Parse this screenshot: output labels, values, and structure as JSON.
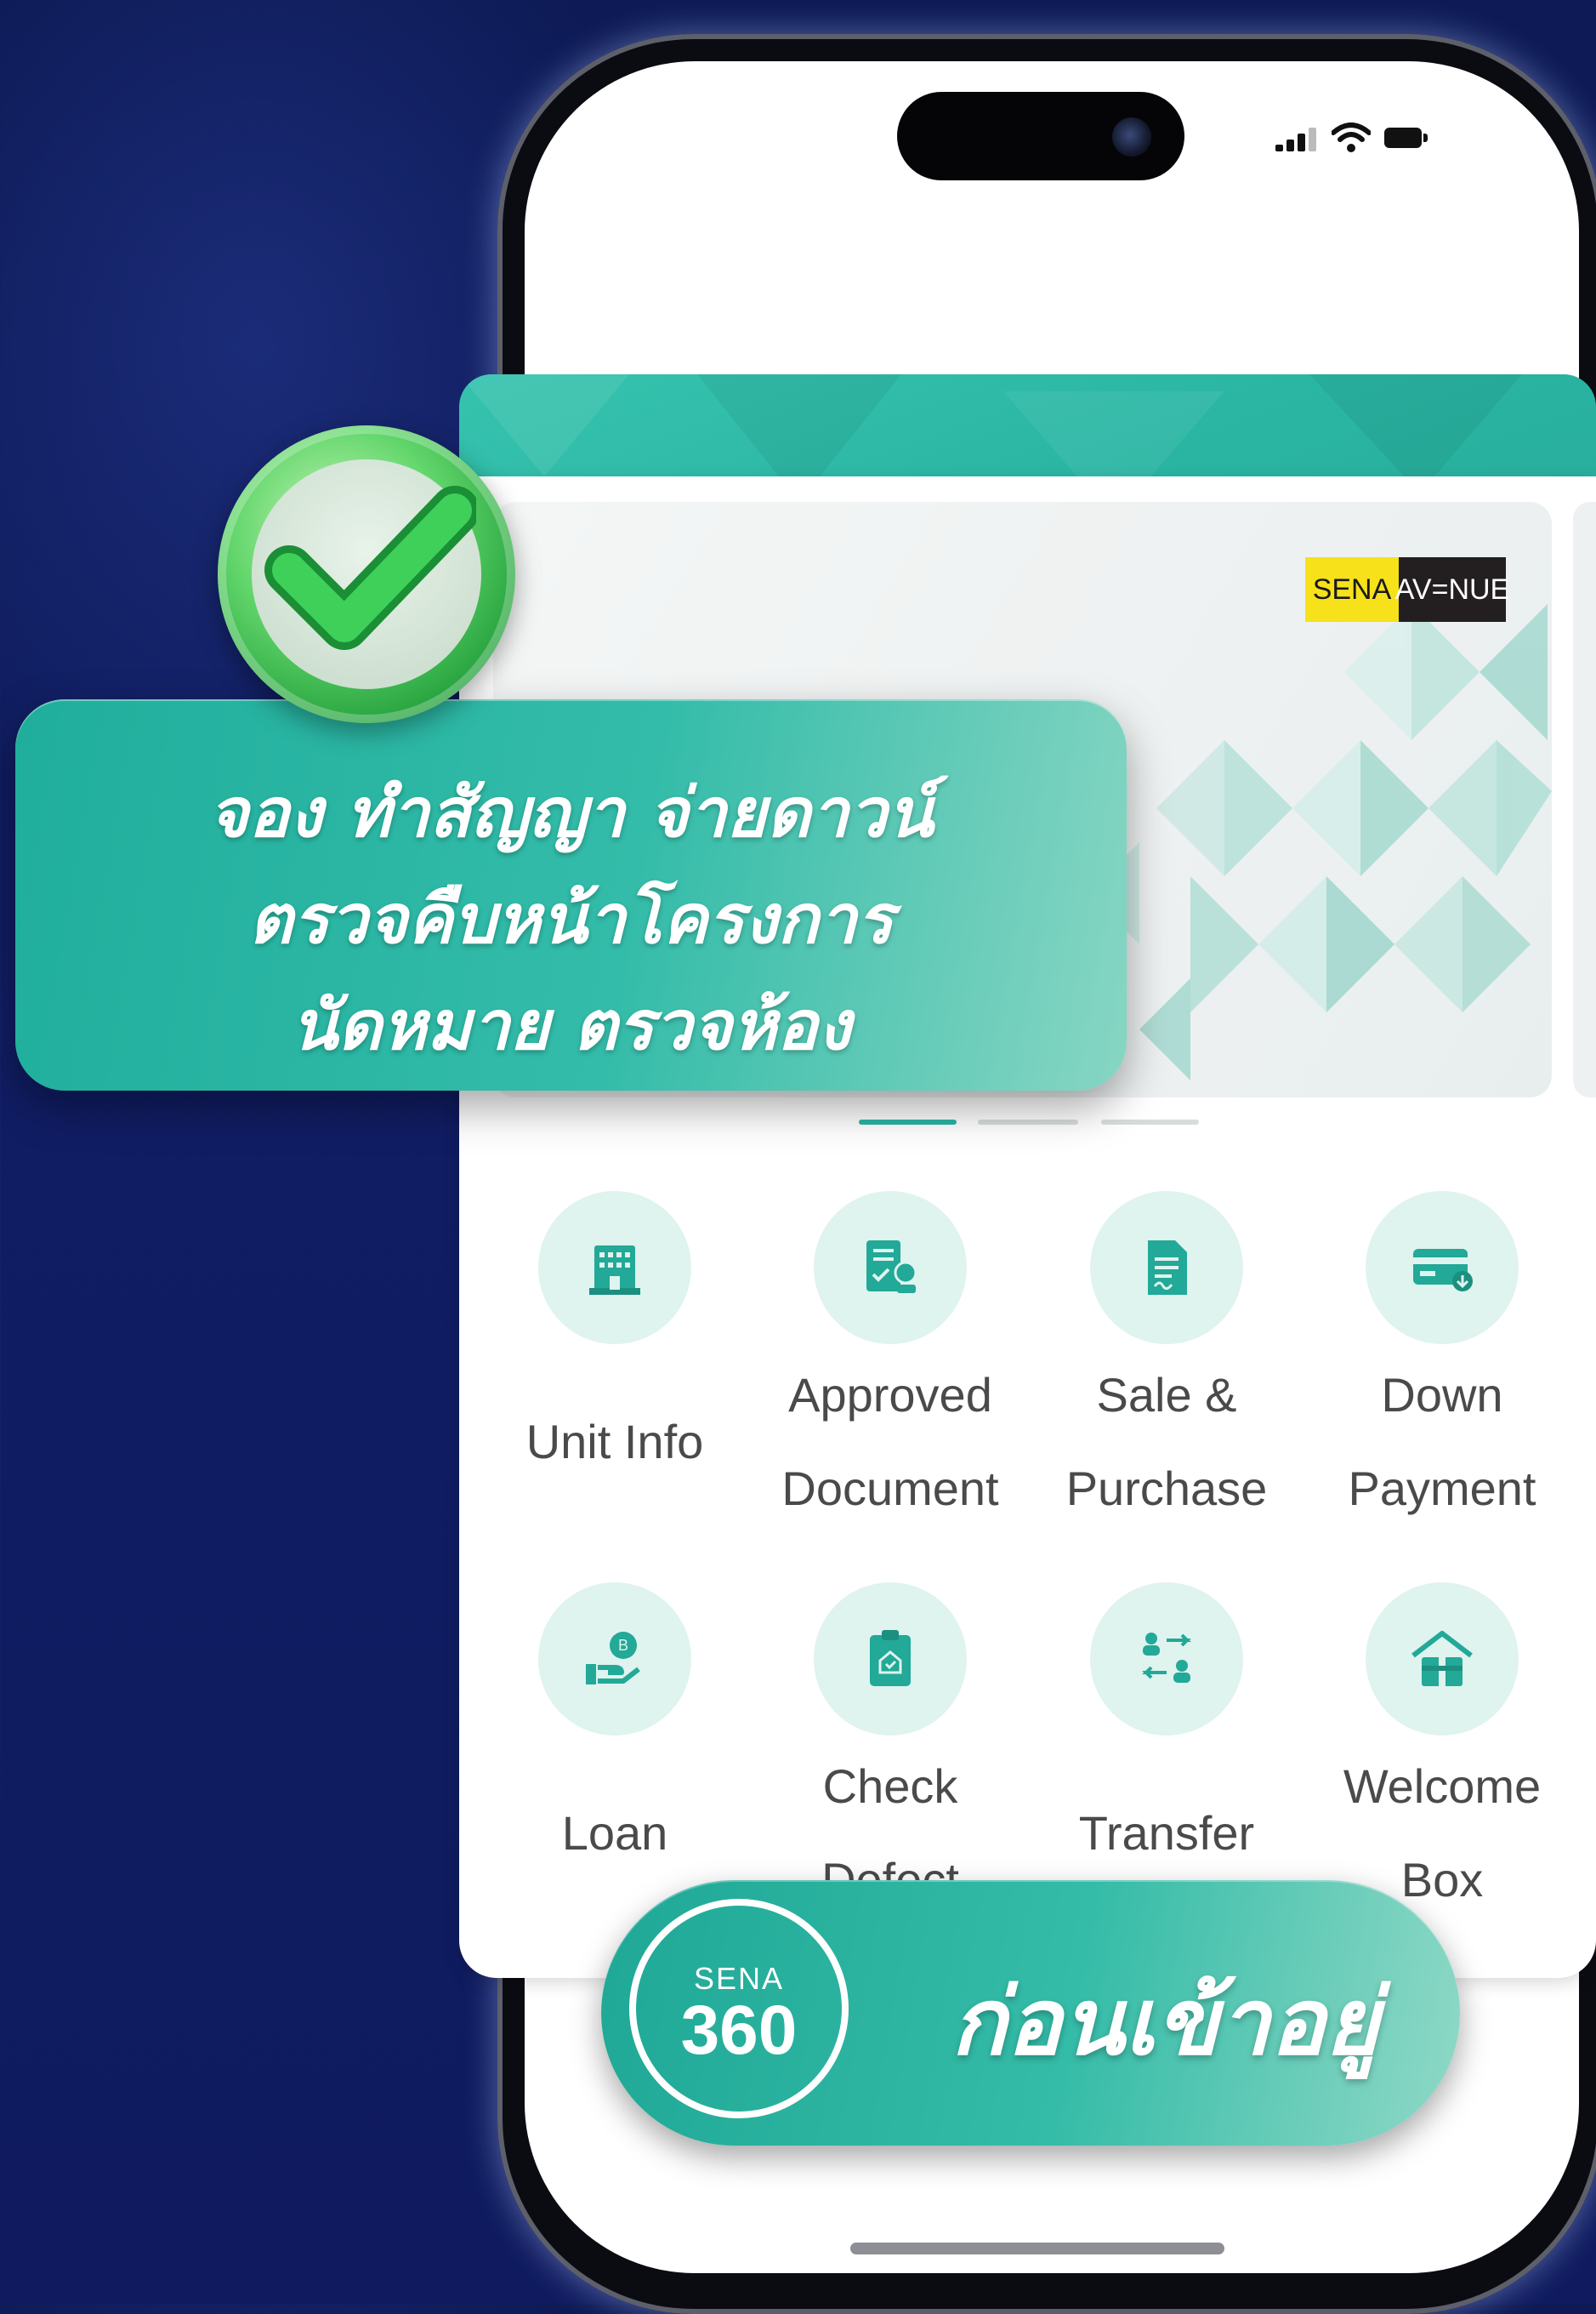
{
  "status_bar": {
    "signal_icon": "cellular-signal-icon",
    "wifi_icon": "wifi-icon",
    "battery_icon": "battery-icon"
  },
  "banner": {
    "brand_left": "SENA",
    "brand_right": "AV=NUE",
    "carousel_pages": 3,
    "active_page": 1
  },
  "overlay": {
    "line1": "จอง ทำสัญญา จ่ายดาวน์",
    "line2": "ตรวจคืบหน้าโครงการ",
    "line3": "นัดหมาย ตรวจห้อง",
    "badge_icon": "check-icon"
  },
  "menu": [
    {
      "line1": "Unit Info",
      "line2": "",
      "icon": "building-icon"
    },
    {
      "line1": "Approved",
      "line2": "Document",
      "icon": "approved-document-icon"
    },
    {
      "line1": "Sale &",
      "line2": "Purchase",
      "icon": "contract-document-icon"
    },
    {
      "line1": "Down",
      "line2": "Payment",
      "icon": "card-payment-icon"
    },
    {
      "line1": "Loan",
      "line2": "",
      "icon": "loan-hand-coin-icon"
    },
    {
      "line1": "Check",
      "line2": "Defect",
      "icon": "clipboard-home-icon"
    },
    {
      "line1": "Transfer",
      "line2": "",
      "icon": "transfer-users-icon"
    },
    {
      "line1": "Welcome",
      "line2": "Box",
      "icon": "welcome-box-house-icon"
    }
  ],
  "pill": {
    "logo_top": "SENA",
    "logo_bottom": "360",
    "text": "ก่อนเข้าอยู่"
  },
  "colors": {
    "teal": "#2ab5a3",
    "icon_teal": "#22a997",
    "icon_bg": "#dff3ef",
    "brand_yellow": "#f6e11a",
    "background_navy": "#0f1b5e"
  }
}
